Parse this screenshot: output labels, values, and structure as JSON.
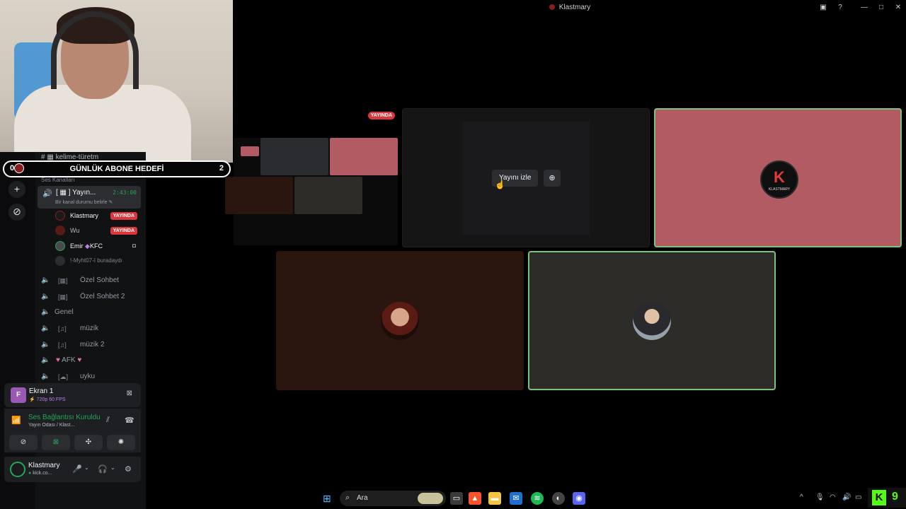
{
  "window": {
    "title": "Klastmary"
  },
  "goal": {
    "label": "GÜNLÜK ABONE HEDEFİ",
    "current": "0",
    "target": "2"
  },
  "sidebar": {
    "text_channel": "kelime-türetm",
    "voice_category": "Ses Kanalları",
    "active_channel": {
      "name": "Yayın...",
      "timer": "2:43:00",
      "status": "Bir kanal durumu belirle"
    },
    "members": [
      {
        "name": "Klastmary",
        "badge": "YAYINDA"
      },
      {
        "name": "Wu",
        "badge": "YAYINDA"
      },
      {
        "name": "Emir",
        "tag": "KFC"
      },
      {
        "name": "!-Myht07-I buradaydı"
      }
    ],
    "channels": [
      {
        "name": "Özel Sohbet"
      },
      {
        "name": "Özel Sohbet 2"
      },
      {
        "name": "Genel"
      },
      {
        "name": "müzik"
      },
      {
        "name": "müzik 2"
      },
      {
        "name": "AFK"
      },
      {
        "name": "uyku"
      }
    ]
  },
  "screen_share": {
    "initial": "F",
    "title": "Ekran 1",
    "quality": "720p 60 FPS"
  },
  "connection": {
    "status": "Ses Bağlantısı Kuruldu",
    "channel": "Yayın Odası / Klast..."
  },
  "user": {
    "name": "Klastmary",
    "status": "kick.co..."
  },
  "stage": {
    "mini_badge": "YAYINDA",
    "watch_button": "Yayını izle",
    "logo_text": "KLASTMARY"
  },
  "taskbar": {
    "search_placeholder": "Ara",
    "kick_count": "9"
  },
  "colors": {
    "live": "#da373c",
    "online": "#23a55a",
    "kick": "#53fc18",
    "tile_klastmary": "#b35b63"
  }
}
